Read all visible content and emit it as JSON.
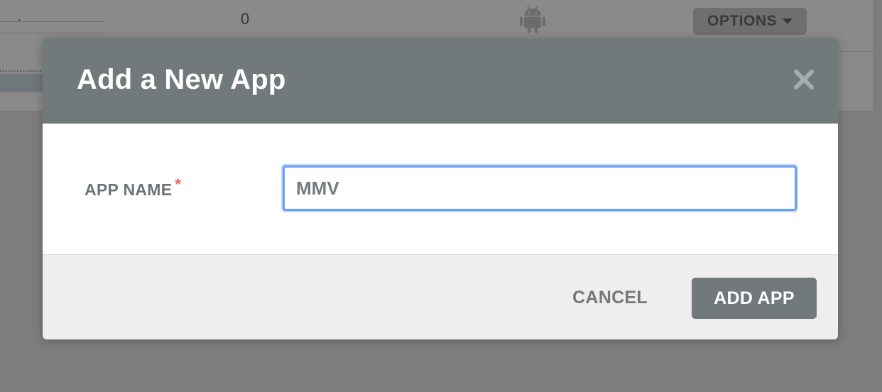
{
  "background": {
    "count": "0",
    "platform_icon": "android-icon",
    "options_label": "OPTIONS",
    "options_icon": "caret-down-icon"
  },
  "modal": {
    "title": "Add a New App",
    "close_icon": "close-icon",
    "field": {
      "label": "APP NAME",
      "required_mark": "*",
      "value": "MMV"
    },
    "cancel_label": "CANCEL",
    "submit_label": "ADD APP"
  },
  "colors": {
    "header": "#72797b",
    "focus_ring": "#6aa1f2",
    "required": "#e8676b",
    "footer": "#eeeeee",
    "overlay": "#7d7d7d"
  }
}
